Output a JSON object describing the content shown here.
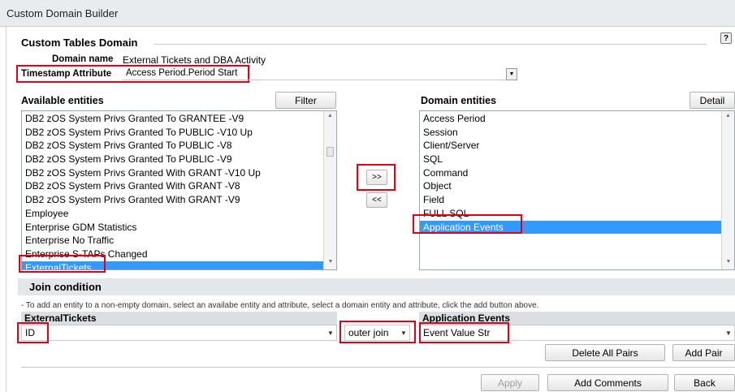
{
  "window": {
    "title": "Custom Domain Builder",
    "help_icon": "help-icon"
  },
  "section": {
    "title": "Custom Tables Domain"
  },
  "domain_name": {
    "label": "Domain name",
    "value": "External Tickets and DBA Activity"
  },
  "timestamp": {
    "label": "Timestamp Attribute",
    "value": "Access Period.Period Start"
  },
  "available": {
    "label": "Available entities",
    "filter_label": "Filter",
    "items": [
      "DB2 zOS System Privs Granted To GRANTEE -V9",
      "DB2 zOS System Privs Granted To PUBLIC -V10 Up",
      "DB2 zOS System Privs Granted To PUBLIC -V8",
      "DB2 zOS System Privs Granted To PUBLIC -V9",
      "DB2 zOS System Privs Granted With GRANT -V10 Up",
      "DB2 zOS System Privs Granted With GRANT -V8",
      "DB2 zOS System Privs Granted With GRANT -V9",
      "Employee",
      "Enterprise GDM Statistics",
      "Enterprise No Traffic",
      "Enterprise S-TAPs Changed",
      "ExternalTickets"
    ],
    "selected": "ExternalTickets"
  },
  "transfer": {
    "add_label": ">>",
    "remove_label": "<<"
  },
  "domain": {
    "label": "Domain entities",
    "detail_label": "Detail",
    "items": [
      "Access Period",
      "Session",
      "Client/Server",
      "SQL",
      "Command",
      "Object",
      "Field",
      "FULL SQL",
      "Application Events"
    ],
    "selected": "Application Events"
  },
  "join": {
    "title": "Join condition",
    "hint": "- To add an entity to a non-empty domain, select an availabe entity and attribute, select a domain entity and attribute, click the add button above.",
    "left_entity": "ExternalTickets",
    "left_attribute": "ID",
    "join_type": "outer join",
    "right_entity": "Application Events",
    "right_attribute": "Event Value Str",
    "delete_all_label": "Delete All Pairs",
    "add_pair_label": "Add Pair"
  },
  "footer": {
    "apply_label": "Apply",
    "comments_label": "Add Comments",
    "back_label": "Back"
  },
  "colors": {
    "selection": "#3399ff",
    "highlight": "#e0001a"
  }
}
